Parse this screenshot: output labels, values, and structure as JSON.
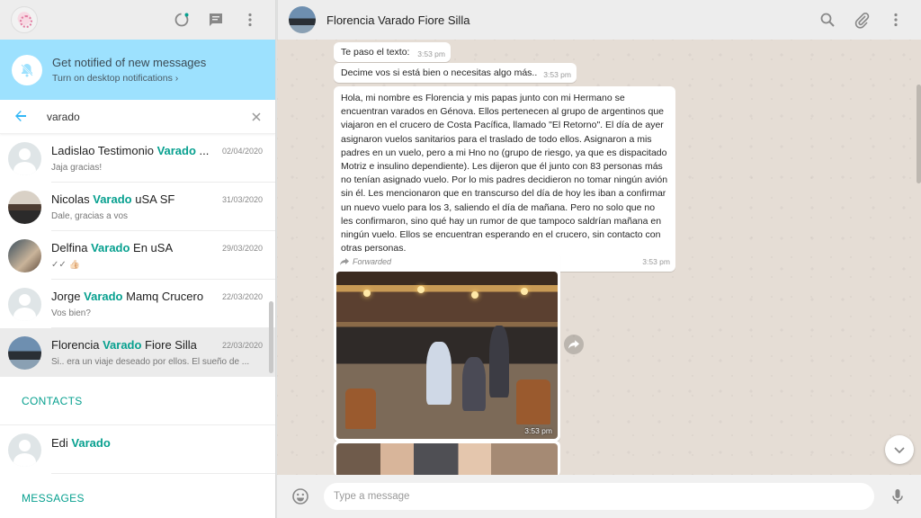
{
  "sidebar": {
    "notification": {
      "title": "Get notified of new messages",
      "subtitle": "Turn on desktop notifications ›"
    },
    "search": {
      "value": "varado"
    },
    "chats": [
      {
        "name_pre": "Ladislao  Testimonio ",
        "highlight": "Varado",
        "name_post": " ...",
        "date": "02/04/2020",
        "snippet": "Jaja gracias!"
      },
      {
        "name_pre": "Nicolas  ",
        "highlight": "Varado",
        "name_post": " uSA SF",
        "date": "31/03/2020",
        "snippet": "Dale, gracias a vos"
      },
      {
        "name_pre": "Delfina  ",
        "highlight": "Varado",
        "name_post": " En uSA",
        "date": "29/03/2020",
        "snippet": "✓✓ 👍🏻"
      },
      {
        "name_pre": "Jorge ",
        "highlight": "Varado",
        "name_post": " Mamq Crucero",
        "date": "22/03/2020",
        "snippet": "Vos bien?"
      },
      {
        "name_pre": "Florencia  ",
        "highlight": "Varado",
        "name_post": " Fiore Silla",
        "date": "22/03/2020",
        "snippet": "Si.. era un viaje deseado por ellos. El sueño de ..."
      }
    ],
    "contacts_label": "CONTACTS",
    "contact": {
      "name_pre": "Edi ",
      "highlight": "Varado"
    },
    "messages_label": "MESSAGES"
  },
  "conversation": {
    "title": "Florencia  Varado Fiore Silla",
    "messages": [
      {
        "text": "Te paso el texto:",
        "time": "3:53 pm"
      },
      {
        "text": "Decime vos si está bien o necesitas algo más..",
        "time": "3:53 pm"
      },
      {
        "text": "Hola, mi nombre es Florencia y mis papas junto con mi Hermano se encuentran varados en Génova. Ellos pertenecen al grupo de argentinos que viajaron en el crucero de Costa Pacífica, llamado \"El Retorno\". El día de ayer asignaron vuelos sanitarios para el traslado de todo ellos. Asignaron a mis padres en un vuelo, pero a mi Hno no (grupo de riesgo, ya que es dispacitado Motriz e insulino dependiente). Les dijeron que él junto con 83 personas más no tenían asignado vuelo. Por lo mis padres decidieron no tomar ningún avión sin él. Les mencionaron que en transcurso del día de hoy les iban a confirmar un nuevo vuelo para los 3, saliendo el día de mañana. Pero no solo que no les confirmaron, sino qué hay un rumor de que tampoco saldrían mañana en ningún vuelo. Ellos se encuentran esperando en el crucero, sin contacto con otras personas.",
        "time": "3:53 pm"
      }
    ],
    "forwarded_label": "Forwarded",
    "photo_time": "3:53 pm",
    "compose_placeholder": "Type a message"
  },
  "icons": [
    "status-icon",
    "new-chat-icon",
    "menu-icon",
    "bell-off-icon",
    "back-arrow-icon",
    "clear-icon",
    "search-icon",
    "attach-icon",
    "emoji-icon",
    "mic-icon",
    "forward-icon",
    "chevron-down-icon"
  ],
  "colors": {
    "accent": "#07a08f",
    "notify_bg": "#9de1fe",
    "header_bg": "#ededed",
    "chat_bg": "#e5ddd5"
  }
}
